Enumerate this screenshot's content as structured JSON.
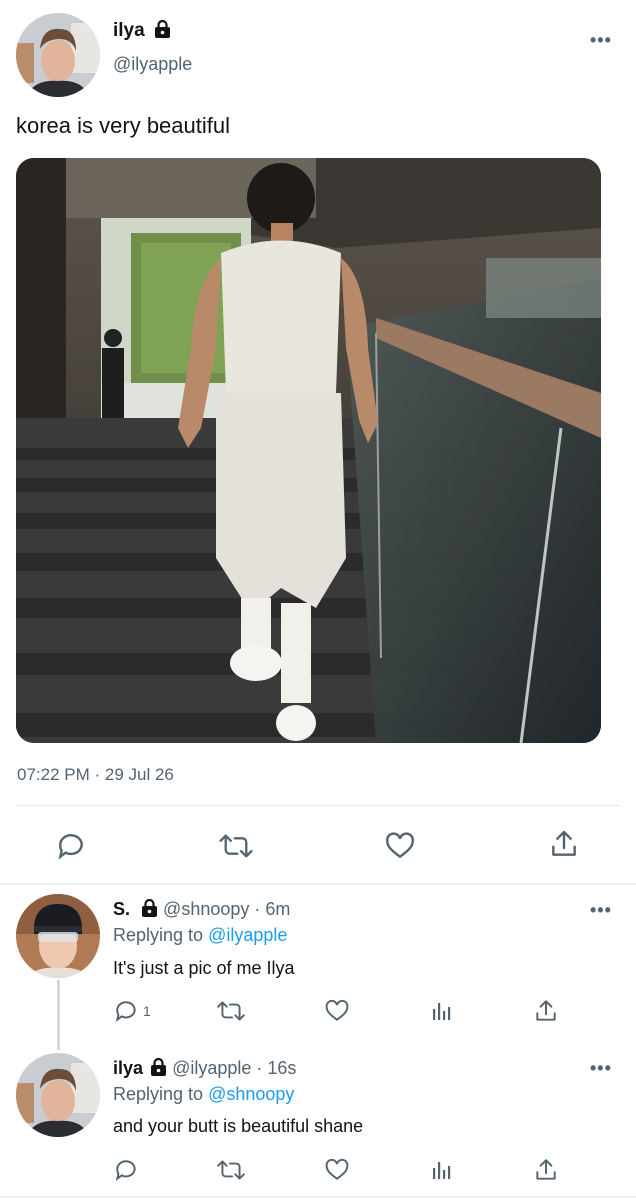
{
  "main_tweet": {
    "name": "ilya",
    "handle": "@ilyapple",
    "text": "korea is very beautiful",
    "timestamp": "07:22 PM · 29 Jul 26",
    "more": "•••"
  },
  "replies": [
    {
      "name": "S.",
      "handle": "@shnoopy",
      "time": "· 6m",
      "replying_prefix": "Replying to ",
      "replying_to": "@ilyapple",
      "text": "It's just a pic of me Ilya",
      "reply_count": "1",
      "more": "•••"
    },
    {
      "name": "ilya",
      "handle": "@ilyapple",
      "time": "· 16s",
      "replying_prefix": "Replying to ",
      "replying_to": "@shnoopy",
      "text": "and your butt is beautiful shane",
      "more": "•••"
    }
  ],
  "icons": [
    "lock-icon",
    "reply-icon",
    "retweet-icon",
    "like-icon",
    "share-icon",
    "analytics-icon",
    "more-icon"
  ],
  "colors": {
    "link": "#1d9bf0",
    "secondary": "#536471",
    "primary": "#0f1419"
  }
}
